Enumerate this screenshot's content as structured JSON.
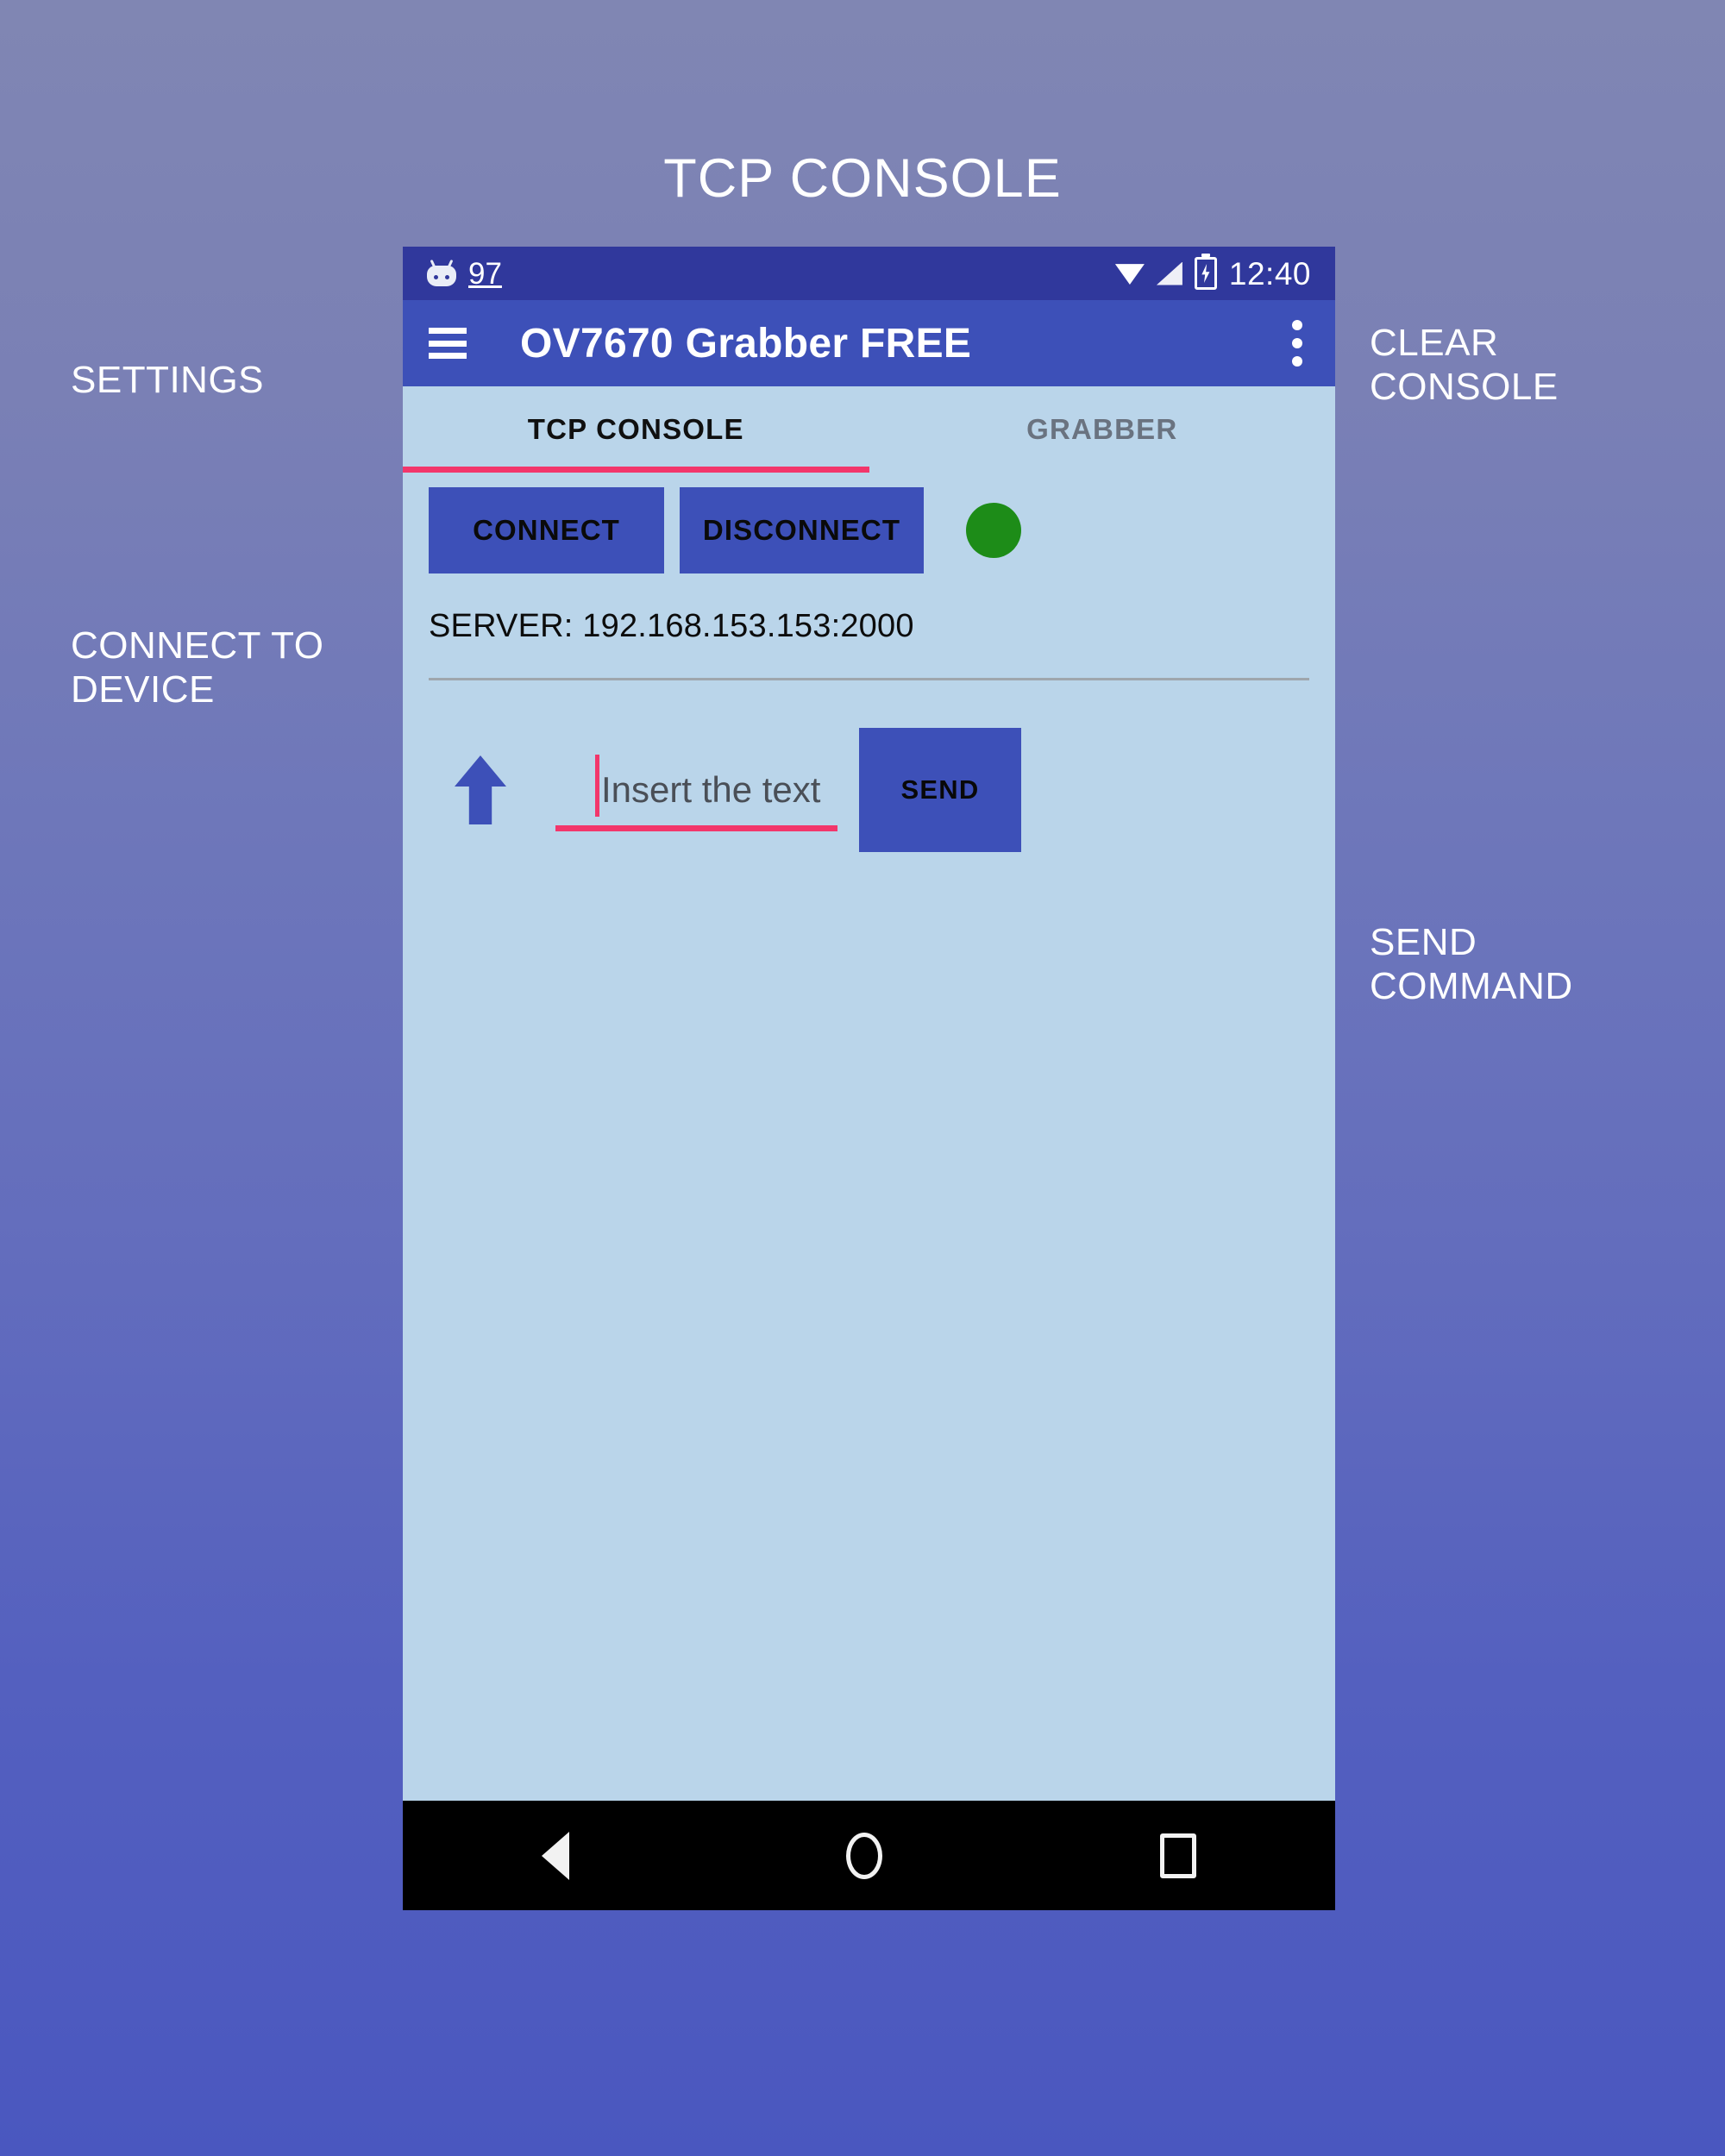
{
  "slide": {
    "title": "TCP CONSOLE"
  },
  "annotations": [
    {
      "id": "settings",
      "label": "SETTINGS"
    },
    {
      "id": "connect-to-device",
      "label": "CONNECT TO\nDEVICE"
    },
    {
      "id": "clear-console",
      "label": "CLEAR\nCONSOLE"
    },
    {
      "id": "send-command",
      "label": "SEND\nCOMMAND"
    }
  ],
  "phone": {
    "status_bar": {
      "battery_percent": "97",
      "clock": "12:40",
      "icons": [
        "android-head-icon",
        "wifi-icon",
        "signal-icon",
        "battery-charging-icon"
      ]
    },
    "app_bar": {
      "menu_icon": "hamburger-icon",
      "title": "OV7670 Grabber FREE",
      "overflow_icon": "kebab-menu-icon"
    },
    "tabs": [
      {
        "label": "TCP CONSOLE",
        "active": true
      },
      {
        "label": "GRABBER",
        "active": false
      }
    ],
    "connection": {
      "connect_label": "CONNECT",
      "disconnect_label": "DISCONNECT",
      "status_indicator": "connected",
      "server_text": "SERVER: 192.168.153.153:2000"
    },
    "send": {
      "send_icon": "up-arrow-icon",
      "input_placeholder": "Insert the text",
      "input_value": "",
      "send_label": "SEND"
    },
    "nav_bar": {
      "back": "back-triangle-icon",
      "home": "home-circle-icon",
      "recents": "recents-square-icon"
    }
  },
  "colors": {
    "status_bar": "#30389c",
    "app_bar": "#3d50b8",
    "screen_bg": "#bad5ea",
    "accent_pink": "#f2366b",
    "status_green": "#1d8c18",
    "nav_bar": "#000000"
  }
}
